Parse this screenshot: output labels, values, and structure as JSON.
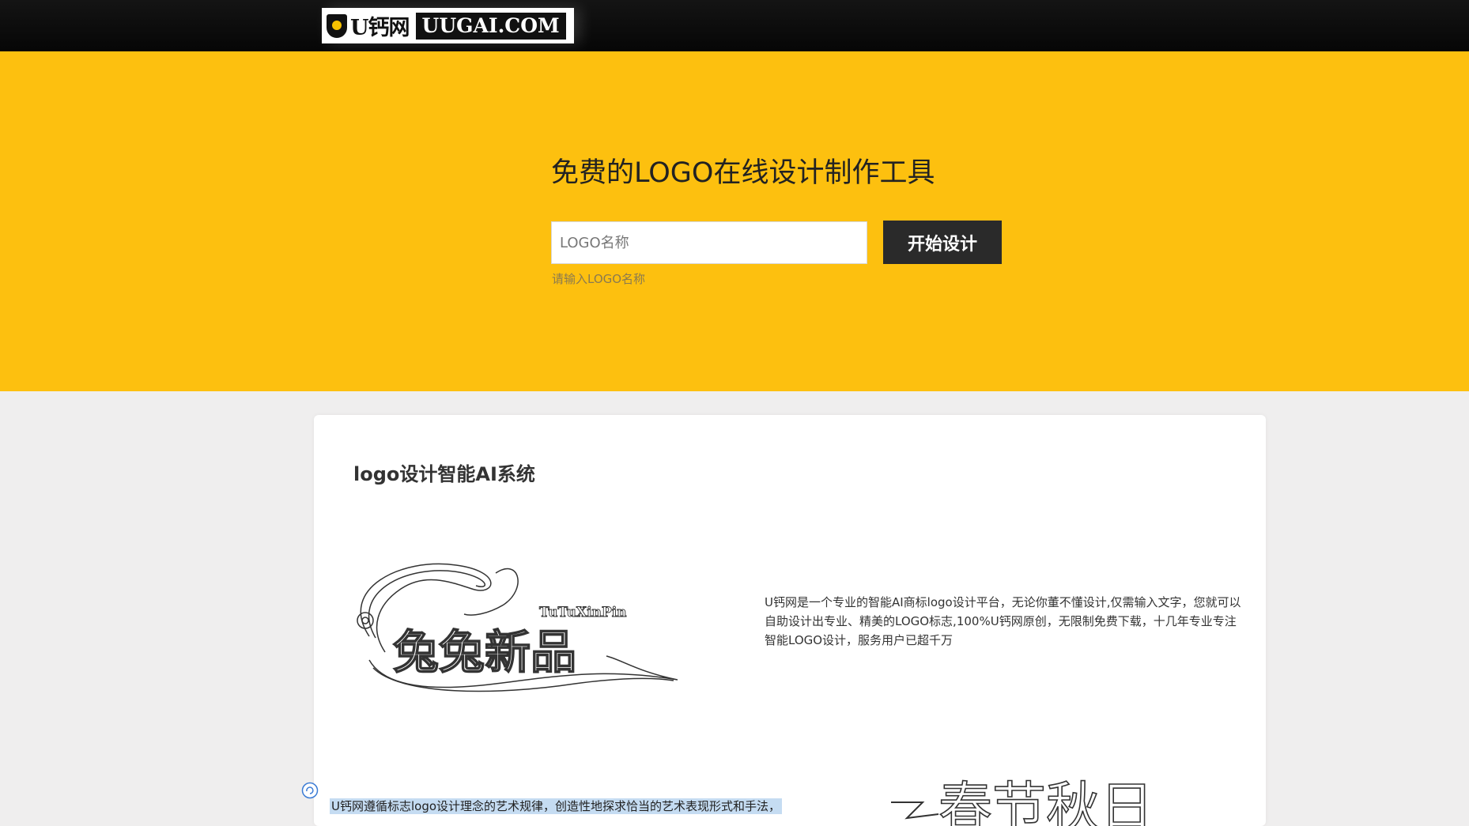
{
  "header": {
    "logo_cn": "U钙网",
    "logo_en": "UUGAI.COM"
  },
  "hero": {
    "title": "免费的LOGO在线设计制作工具",
    "input_placeholder": "LOGO名称",
    "input_value": "",
    "start_button_label": "开始设计",
    "input_hint": "请输入LOGO名称"
  },
  "section": {
    "title": "logo设计智能AI系统",
    "intro": "U钙网是一个专业的智能AI商标logo设计平台，无论你董不懂设计,仅需输入文字，您就可以自助设计出专业、精美的LOGO标志,100%U钙网原创，无限制免费下载，十几年专业专注智能LOGO设计，服务用户已超千万",
    "sample1_title": "兔兔新品",
    "sample1_subtitle": "TuTuXinPin",
    "sample2_title": "春节秋日",
    "selected_text": "U钙网遵循标志logo设计理念的艺术规律，创造性地探求恰当的艺术表现形式和手法，"
  },
  "colors": {
    "topbar": "#0a0a0a",
    "hero_bg": "#fdc00f",
    "button_bg": "#2a2a2a",
    "page_bg": "#efeeee"
  },
  "icons": {
    "logo": "shield-icon",
    "chat": "chat-bubble-icon"
  }
}
